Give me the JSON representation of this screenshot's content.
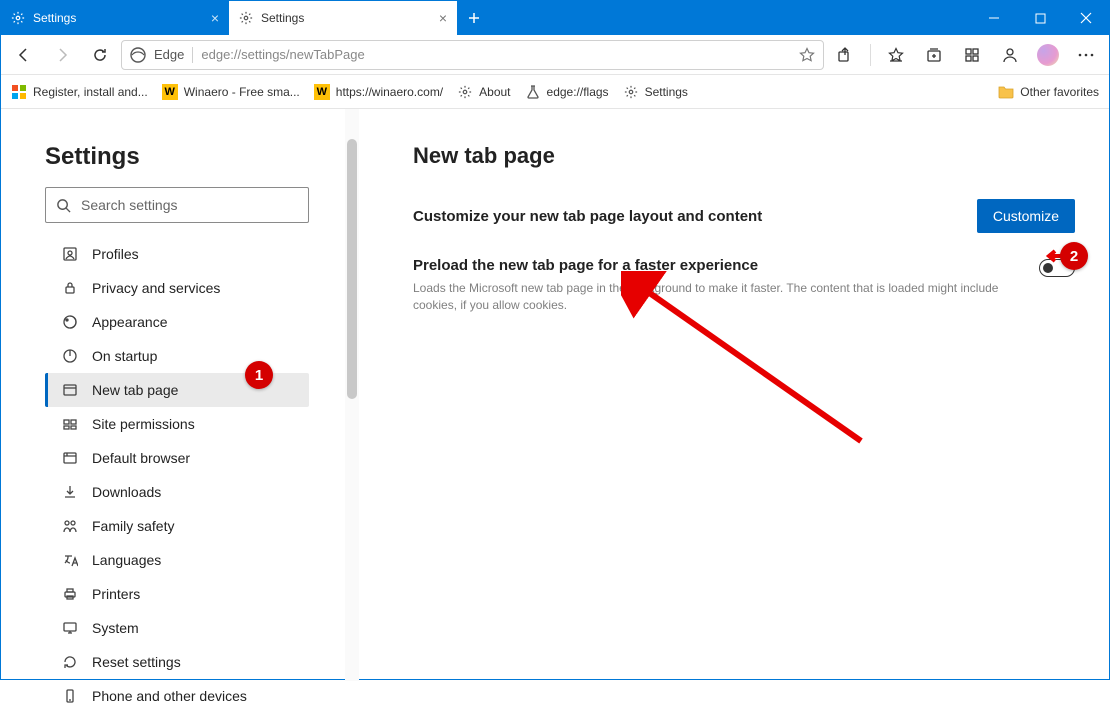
{
  "titlebar": {
    "tabs": [
      {
        "label": "Settings",
        "active": false
      },
      {
        "label": "Settings",
        "active": true
      }
    ],
    "new_tab_tip": "+"
  },
  "toolbar": {
    "edge_label": "Edge",
    "url": "edge://settings/newTabPage"
  },
  "bookmarks": [
    {
      "icon": "grid-win",
      "label": "Register, install and..."
    },
    {
      "icon": "w",
      "label": "Winaero - Free sma..."
    },
    {
      "icon": "w",
      "label": "https://winaero.com/"
    },
    {
      "icon": "gear",
      "label": "About"
    },
    {
      "icon": "flask",
      "label": "edge://flags"
    },
    {
      "icon": "gear",
      "label": "Settings"
    }
  ],
  "other_favorites": "Other favorites",
  "sidebar": {
    "title": "Settings",
    "search_placeholder": "Search settings",
    "items": [
      {
        "label": "Profiles",
        "icon": "profile"
      },
      {
        "label": "Privacy and services",
        "icon": "lock"
      },
      {
        "label": "Appearance",
        "icon": "appearance"
      },
      {
        "label": "On startup",
        "icon": "power"
      },
      {
        "label": "New tab page",
        "icon": "tab",
        "selected": true
      },
      {
        "label": "Site permissions",
        "icon": "permissions"
      },
      {
        "label": "Default browser",
        "icon": "browser"
      },
      {
        "label": "Downloads",
        "icon": "download"
      },
      {
        "label": "Family safety",
        "icon": "family"
      },
      {
        "label": "Languages",
        "icon": "language"
      },
      {
        "label": "Printers",
        "icon": "printer"
      },
      {
        "label": "System",
        "icon": "system"
      },
      {
        "label": "Reset settings",
        "icon": "reset"
      },
      {
        "label": "Phone and other devices",
        "icon": "phone"
      }
    ]
  },
  "main": {
    "title": "New tab page",
    "customize_heading": "Customize your new tab page layout and content",
    "customize_button": "Customize",
    "preload_heading": "Preload the new tab page for a faster experience",
    "preload_desc": "Loads the Microsoft new tab page in the background to make it faster. The content that is loaded might include cookies, if you allow cookies.",
    "preload_toggle": false
  },
  "annotations": {
    "badge1": "1",
    "badge2": "2"
  }
}
